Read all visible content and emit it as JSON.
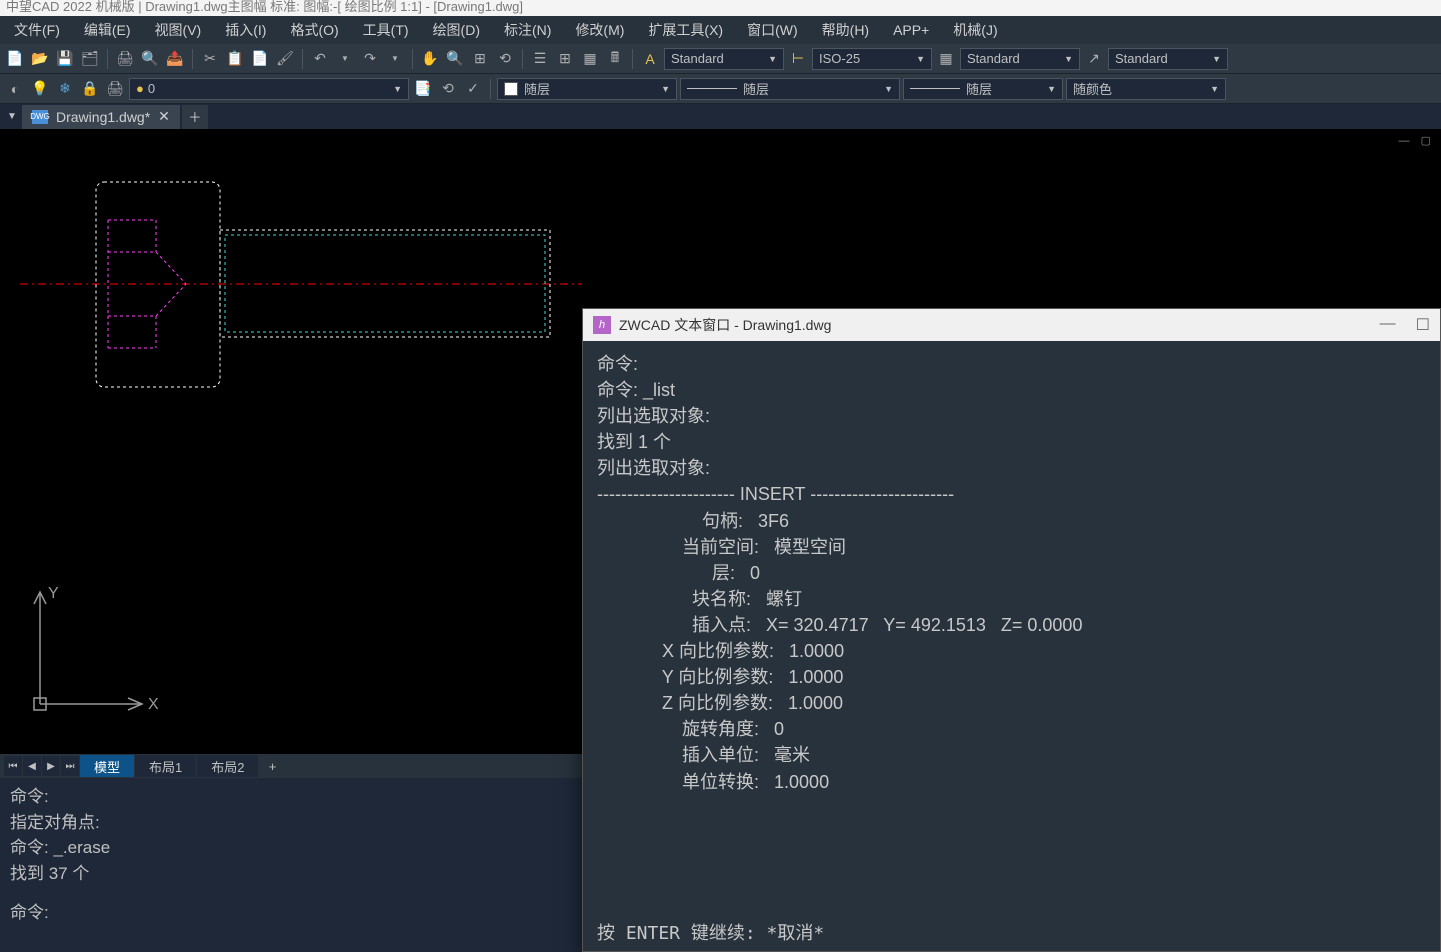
{
  "titlebar": "中望CAD 2022 机械版 | Drawing1.dwg主图幅  标准: 图幅:-[ 绘图比例 1:1] - [Drawing1.dwg]",
  "menu": {
    "file": "文件(F)",
    "edit": "编辑(E)",
    "view": "视图(V)",
    "insert": "插入(I)",
    "format": "格式(O)",
    "tools": "工具(T)",
    "draw": "绘图(D)",
    "dim": "标注(N)",
    "modify": "修改(M)",
    "ext": "扩展工具(X)",
    "window": "窗口(W)",
    "help": "帮助(H)",
    "app": "APP+",
    "mech": "机械(J)"
  },
  "toolbar1": {
    "style1": "Standard",
    "dimstyle": "ISO-25",
    "style2": "Standard",
    "style3": "Standard"
  },
  "toolbar2": {
    "layer": "0",
    "bylayer1": "随层",
    "bylayer2": "随层",
    "bylayer3": "随层",
    "bylayer_color": "随颜色"
  },
  "filetab": {
    "name": "Drawing1.dwg*"
  },
  "layout": {
    "model": "模型",
    "layout1": "布局1",
    "layout2": "布局2"
  },
  "cmd": {
    "l1": "命令:",
    "l2": "指定对角点:",
    "l3": "命令: _.erase",
    "l4": "找到 37 个",
    "l5": "命令:"
  },
  "tw": {
    "title": "ZWCAD 文本窗口 - Drawing1.dwg",
    "l1": "命令:",
    "l2": "命令: _list",
    "l3": "",
    "l4": "列出选取对象:",
    "l5": "找到 1 个",
    "l6": "",
    "l7": "列出选取对象:",
    "l8": "----------------------- INSERT ------------------------",
    "l9": "                     句柄:   3F6",
    "l10": "                 当前空间:   模型空间",
    "l11": "                       层:   0",
    "l12": "                   块名称:   螺钉",
    "l13": "                   插入点:   X= 320.4717   Y= 492.1513   Z= 0.0000",
    "l14": "             X 向比例参数:   1.0000",
    "l15": "             Y 向比例参数:   1.0000",
    "l16": "             Z 向比例参数:   1.0000",
    "l17": "                 旋转角度:   0",
    "l18": "                 插入单位:   毫米",
    "l19": "                 单位转换:   1.0000",
    "footer": "按 ENTER 键继续: *取消*"
  },
  "ucs": {
    "x": "X",
    "y": "Y"
  }
}
